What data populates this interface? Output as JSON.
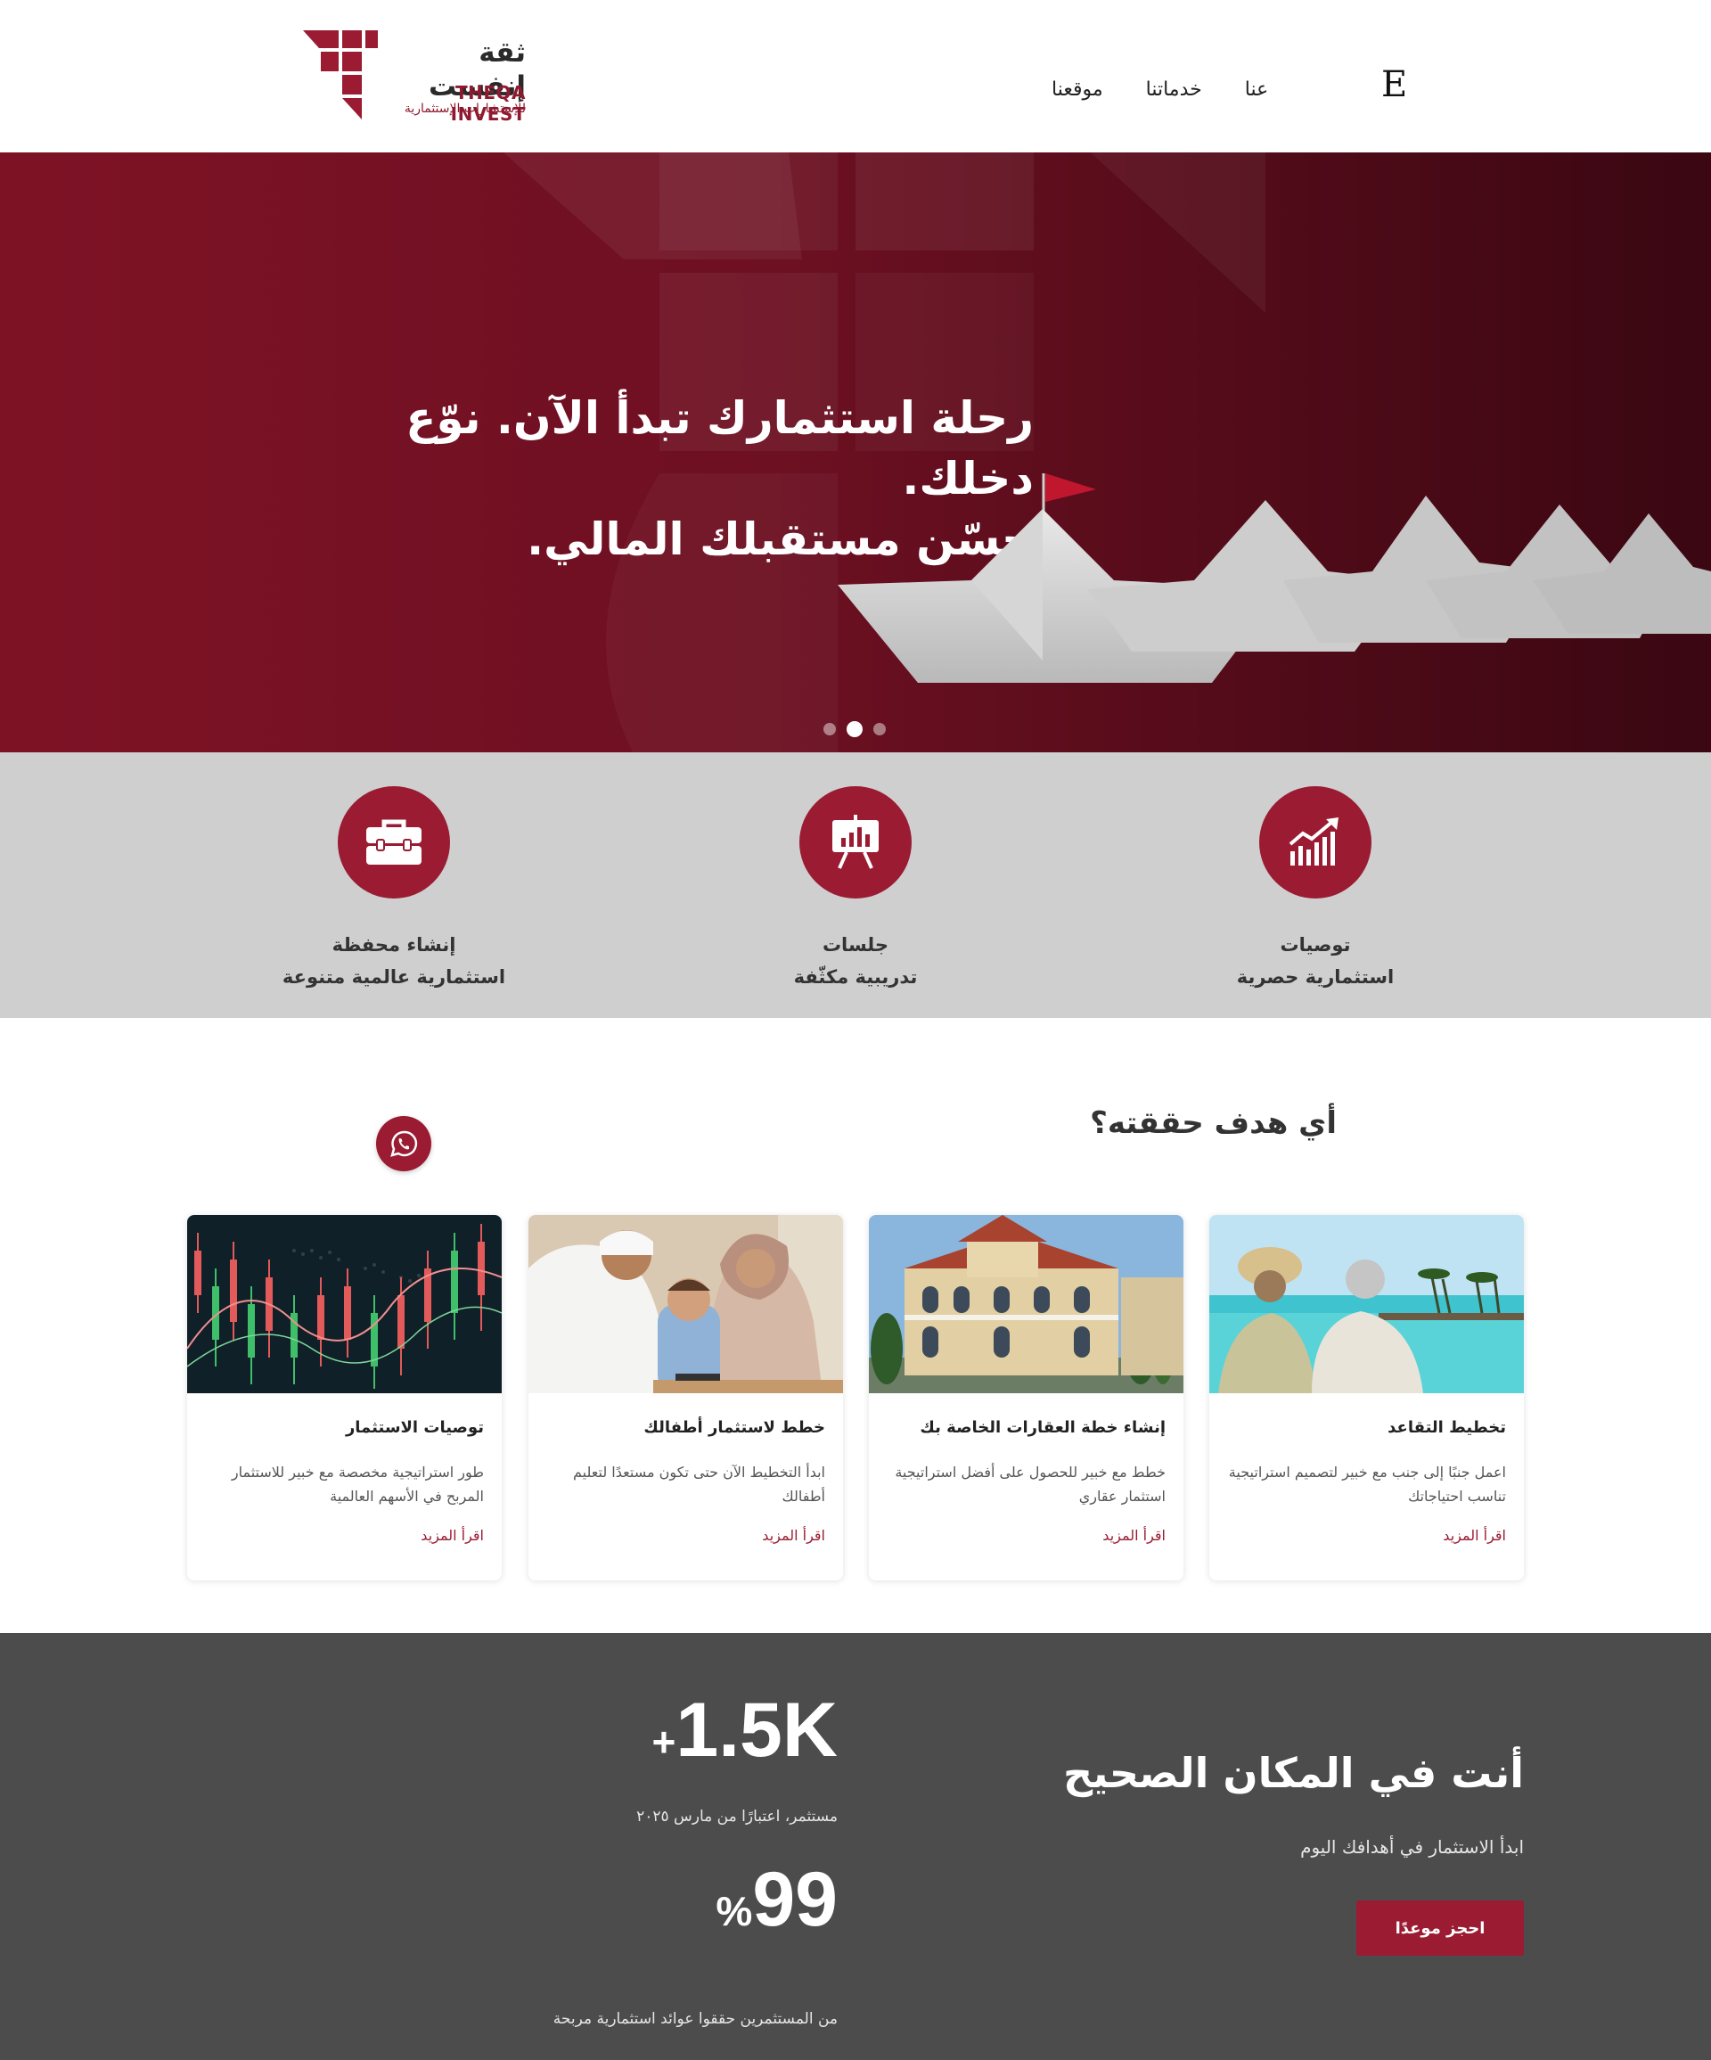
{
  "header": {
    "logo_ar": "ثقة إنفست",
    "logo_en": "THEQA INVEST",
    "logo_sub": "للإستشارات الإستثمارية",
    "nav": [
      "موقعنا",
      "خدماتنا",
      "عنا"
    ],
    "lang_switch": "E"
  },
  "hero": {
    "line1": "رحلة استثمارك تبدأ الآن. نوّع دخلك.",
    "line2": "حسّن مستقبلك المالي.",
    "slides_count": 3,
    "active_slide": 2
  },
  "features": [
    {
      "icon": "chart-growth-icon",
      "line1": "توصيات",
      "line2": "استثمارية حصرية"
    },
    {
      "icon": "presentation-board-icon",
      "line1": "جلسات",
      "line2": "تدريبية مكثّفة"
    },
    {
      "icon": "briefcase-icon",
      "line1": "إنشاء محفظة",
      "line2": "استثمارية عالمية متنوعة"
    }
  ],
  "goals": {
    "title": "أي هدف حققته؟",
    "cards": [
      {
        "image": "retired-couple-beach",
        "title": "تخطيط التقاعد",
        "desc": "اعمل جنبًا إلى جنب مع خبير لتصميم استراتيجية تناسب احتياجاتك",
        "more": "اقرأ المزيد"
      },
      {
        "image": "villa-building",
        "title": "إنشاء خطة العقارات الخاصة بك",
        "desc": "خطط مع خبير للحصول على أفضل استراتيجية استثمار عقاري",
        "more": "اقرأ المزيد"
      },
      {
        "image": "family-with-child",
        "title": "خطط لاستثمار أطفالك",
        "desc": "ابدأ التخطيط الآن حتى تكون مستعدًا لتعليم أطفالك",
        "more": "اقرأ المزيد"
      },
      {
        "image": "stock-candlestick-chart",
        "title": "توصيات الاستثمار",
        "desc": "طور استراتيجية مخصصة مع خبير للاستثمار المربح في الأسهم العالمية",
        "more": "اقرأ المزيد"
      }
    ]
  },
  "stats": {
    "title": "أنت في المكان الصحيح",
    "subtitle": "ابدأ الاستثمار في أهدافك اليوم",
    "button": "احجز موعدًا",
    "stat1_value": "1.5K",
    "stat1_suffix": "+",
    "stat1_label": "مستثمر، اعتبارًا من مارس ٢٠٢٥",
    "stat2_value": "99",
    "stat2_suffix": "%",
    "stat2_label": "من المستثمرين حققوا عوائد استثمارية مربحة"
  },
  "colors": {
    "brand": "#9a1b32",
    "hero_dark": "#4c0a17",
    "strip_grey": "#cfcfcf",
    "stats_bg": "#4c4c4c"
  }
}
